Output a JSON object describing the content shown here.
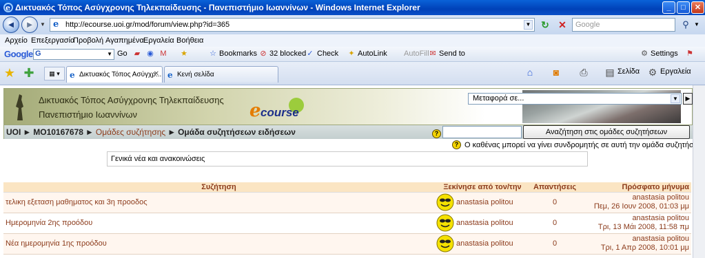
{
  "window": {
    "title": "Δικτυακός Τόπος Ασύγχρονης Τηλεκπαίδευσης - Πανεπιστήμιο Ιωαννίνων - Windows Internet Explorer",
    "minimize": "_",
    "maximize": "□",
    "close": "✕"
  },
  "address": {
    "url": "http://ecourse.uoi.gr/mod/forum/view.php?id=365",
    "search_placeholder": "Google"
  },
  "menu": [
    "Αρχείο",
    "Επεξεργασία",
    "Προβολή",
    "Αγαπημένα",
    "Εργαλεία",
    "Βοήθεια"
  ],
  "google_toolbar": {
    "logo": "Google",
    "search_value": "G",
    "go": "Go",
    "bookmarks": "Bookmarks",
    "blocked": "32 blocked",
    "check": "Check",
    "autolink": "AutoLink",
    "autofill": "AutoFill",
    "sendto": "Send to",
    "settings": "Settings"
  },
  "tabs": [
    {
      "label": "Δικτυακός Τόπος Ασύγχρ...",
      "active": true
    },
    {
      "label": "Κενή σελίδα",
      "active": false
    }
  ],
  "command_bar": {
    "page": "Σελίδα",
    "tools": "Εργαλεία"
  },
  "site": {
    "title_line1": "Δικτυακός Τόπος Ασύγχρονης Τηλεκπαίδευσης",
    "title_line2": "Πανεπιστήμιο Ιωαννίνων",
    "logo_e": "e",
    "logo_text": "course",
    "jump_to": "Μεταφορά σε...",
    "jump_go": "▶"
  },
  "breadcrumb": {
    "items": [
      "UOI",
      "MO10167678",
      "Ομάδες συζήτησης",
      "Ομάδα συζητήσεων ειδήσεων"
    ],
    "separator": "►"
  },
  "forum": {
    "search_button": "Αναζήτηση στις ομάδες συζητήσεων",
    "search_value": "",
    "subscribe_note": "Ο καθένας μπορεί να γίνει συνδρομητής σε αυτή την ομάδα συζητήσεων",
    "intro": "Γενικά νέα και ανακοινώσεις",
    "help": "?"
  },
  "table": {
    "headers": {
      "discussion": "Συζήτηση",
      "started_by": "Ξεκίνησε από τον/την",
      "replies": "Απαντήσεις",
      "last_post": "Πρόσφατο μήνυμα"
    },
    "rows": [
      {
        "topic": "τελικη εξεταση μαθηματος και 3η προοδος",
        "author": "anastasia politou",
        "replies": "0",
        "last_author": "anastasia politou",
        "last_date": "Πεμ, 26 Ιουν 2008, 01:03 μμ"
      },
      {
        "topic": "Ημερομηνία 2ης προόδου",
        "author": "anastasia politou",
        "replies": "0",
        "last_author": "anastasia politou",
        "last_date": "Τρι, 13 Μάι 2008, 11:58 πμ"
      },
      {
        "topic": "Νέα ημερομηνία 1ης προόδου",
        "author": "anastasia politou",
        "replies": "0",
        "last_author": "anastasia politou",
        "last_date": "Τρι, 1 Απρ 2008, 10:01 μμ"
      }
    ]
  }
}
